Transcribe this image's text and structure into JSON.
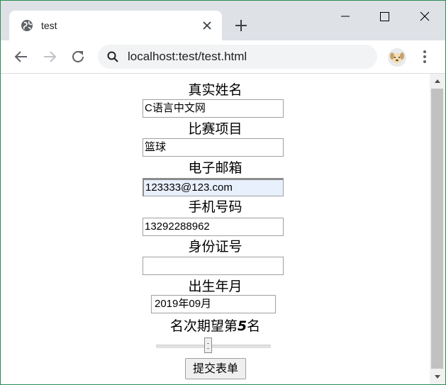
{
  "browser": {
    "tab_title": "test",
    "url": "localhost:test/test.html"
  },
  "form": {
    "fields": [
      {
        "label": "真实姓名",
        "value": "C语言中文网"
      },
      {
        "label": "比赛项目",
        "value": "篮球"
      },
      {
        "label": "电子邮箱",
        "value": "123333@123.com"
      },
      {
        "label": "手机号码",
        "value": "13292288962"
      },
      {
        "label": "身份证号",
        "value": ""
      },
      {
        "label": "出生年月",
        "value": "2019年09月"
      }
    ],
    "rank_label_prefix": "名次期望第",
    "rank_value": "5",
    "rank_label_suffix": "名",
    "slider_fraction": 0.45,
    "submit_label": "提交表单"
  },
  "icons": {
    "tab": "globe-icon",
    "close": "close-icon",
    "new_tab": "plus-icon",
    "back": "arrow-left-icon",
    "forward": "arrow-right-icon",
    "reload": "reload-icon",
    "search": "search-icon",
    "profile": "avatar-icon",
    "menu": "kebab-menu-icon"
  },
  "colors": {
    "chrome_frame": "#dee1e6",
    "omnibox": "#f1f3f4",
    "autofill": "#e8f0fe",
    "window_border": "#2e8b57"
  }
}
